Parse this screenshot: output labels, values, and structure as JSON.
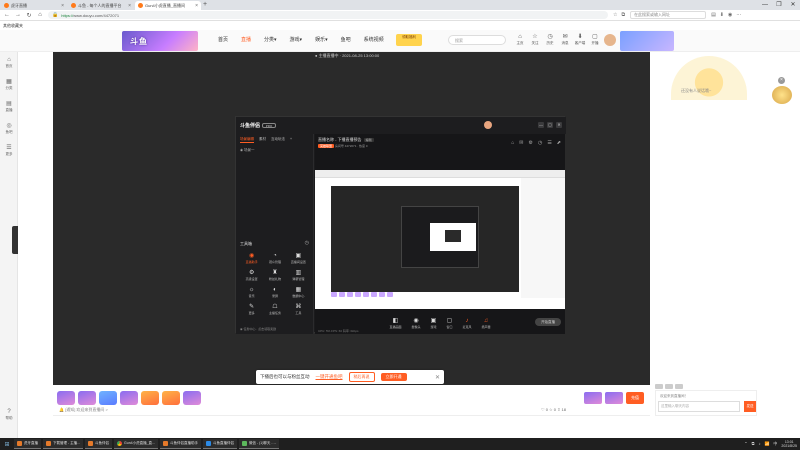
{
  "browser": {
    "tabs": [
      {
        "label": "虎牙直播",
        "active": false
      },
      {
        "label": "斗鱼 - 每个人的直播平台",
        "active": false
      },
      {
        "label": "Gun4小虎直播_直播间",
        "active": true
      }
    ],
    "new_tab": "+",
    "window_controls": [
      "—",
      "❐",
      "✕"
    ],
    "url_protocol": "https://",
    "url_rest": "www.douyu.com/4472071",
    "address_search_placeholder": "在此搜索或输入网址",
    "bookmark_label": "其他收藏夹"
  },
  "site": {
    "banner_text": "斗鱼",
    "nav": [
      "首页",
      "直播",
      "分类▾",
      "游戏▾",
      "娱乐▾",
      "鱼吧",
      "系统视频"
    ],
    "nav_active_index": 1,
    "promo_text": "领取福利",
    "search_placeholder": "搜索",
    "header_icons": [
      {
        "glyph": "⌂",
        "label": "主页"
      },
      {
        "glyph": "☆",
        "label": "关注"
      },
      {
        "glyph": "◷",
        "label": "历史"
      },
      {
        "glyph": "✉",
        "label": "消息"
      },
      {
        "glyph": "⬇",
        "label": "客户端"
      },
      {
        "glyph": "▢",
        "label": "开播"
      }
    ]
  },
  "sidebar": [
    {
      "glyph": "⌂",
      "label": "首页"
    },
    {
      "glyph": "▦",
      "label": "分类"
    },
    {
      "glyph": "▤",
      "label": "直播"
    },
    {
      "glyph": "◎",
      "label": "鱼吧"
    },
    {
      "glyph": "☰",
      "label": "更多"
    }
  ],
  "sidebar_bottom": {
    "glyph": "?",
    "label": "帮助"
  },
  "player": {
    "label": "● 主播直播中 · 2021-08-25 13:00:00",
    "app": {
      "logo": "斗鱼伴侣",
      "logo_badge": "PRO",
      "window_controls": [
        "—",
        "▢",
        "✕"
      ],
      "left_tabs": [
        "场景编辑",
        "素材",
        "互动玩法",
        "+"
      ],
      "left_tab_active": 0,
      "scene_label": "◉ 场景一",
      "toolbox_title": "工具箱",
      "tools": [
        {
          "glyph": "◉",
          "label": "直播助手",
          "hot": true
        },
        {
          "glyph": "◔",
          "label": "观众管理",
          "hot": false
        },
        {
          "glyph": "▣",
          "label": "直播间设置",
          "hot": false
        },
        {
          "glyph": "⚙",
          "label": "高级设置",
          "hot": false
        },
        {
          "glyph": "♜",
          "label": "粉丝礼物",
          "hot": false
        },
        {
          "glyph": "▥",
          "label": "弹幕管理",
          "hot": false
        },
        {
          "glyph": "☼",
          "label": "音乐",
          "hot": false
        },
        {
          "glyph": "◐",
          "label": "录屏",
          "hot": false
        },
        {
          "glyph": "▦",
          "label": "数据中心",
          "hot": false
        },
        {
          "glyph": "✎",
          "label": "更多",
          "hot": false
        },
        {
          "glyph": "☖",
          "label": "主播任务",
          "hot": false
        },
        {
          "glyph": "⌘",
          "label": "工具",
          "hot": false
        }
      ],
      "footer": "◉ 任务中心 · 点击领取奖励",
      "title": "直播名称 - 下播直播预告",
      "title_chip": "编辑",
      "sub_category": "英雄联盟",
      "sub_extra": "房间号 4472071 · 热度 0",
      "top_icons": [
        "⌂",
        "✉",
        "⚙",
        "◷",
        "☰",
        "⬈"
      ],
      "bottom_buttons": [
        {
          "glyph": "◧",
          "label": "直播画面",
          "red": false
        },
        {
          "glyph": "◉",
          "label": "摄像头",
          "red": false
        },
        {
          "glyph": "▣",
          "label": "游戏",
          "red": false
        },
        {
          "glyph": "▢",
          "label": "窗口",
          "red": false
        },
        {
          "glyph": "♪",
          "label": "麦克风",
          "red": true
        },
        {
          "glyph": "♫",
          "label": "扬声器",
          "red": true
        }
      ],
      "start_button": "开始直播",
      "status": "CPU: 5%  FPS: 60  码率: 0kbps"
    }
  },
  "notice": {
    "text": "下播后也可以与粉丝互动",
    "link": "一键开通鱼吧",
    "button1": "稍后再说",
    "button2": "立即开通",
    "close": "✕"
  },
  "gifts": {
    "note": "🔔 [通知] 欢迎来到直播间 >",
    "stats": "♡ 0  ☆ 0  ⇧ 18",
    "pay_label": "充值"
  },
  "chat": {
    "mascot_caption": "还没有人说话哦~",
    "message": "欢迎来到直播间！",
    "input_placeholder": "这里输入聊天内容",
    "send": "发送"
  },
  "taskbar": {
    "start": "⊞",
    "tasks": [
      {
        "label": "虎牙直播",
        "icon": ""
      },
      {
        "label": "下载管理 - 主播...",
        "icon": ""
      },
      {
        "label": "斗鱼伴侣",
        "icon": ""
      },
      {
        "label": "Gun4小虎直播_直...",
        "icon": "chrome"
      },
      {
        "label": "斗鱼伴侣直播助手",
        "icon": ""
      },
      {
        "label": "斗鱼直播伴侣",
        "icon": "blue"
      },
      {
        "label": "微信 - (1)聊天 - ...",
        "icon": "green"
      }
    ],
    "tray_icons": [
      "⌃",
      "⧉",
      "♪",
      "📶",
      "中"
    ],
    "time": "13:01",
    "date": "2021/8/25"
  }
}
